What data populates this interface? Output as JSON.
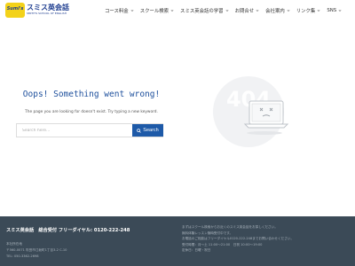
{
  "header": {
    "logo": {
      "badge_text": "Sumi's",
      "main_text": "スミス英会話",
      "sub_text": "SMITH'S SCHOOL OF ENGLISH"
    },
    "nav": [
      {
        "label": "コース料金"
      },
      {
        "label": "スクール検索"
      },
      {
        "label": "スミス英会話の学習"
      },
      {
        "label": "お問合せ"
      },
      {
        "label": "会社案内"
      },
      {
        "label": "リンク集"
      },
      {
        "label": "SNS"
      }
    ]
  },
  "main": {
    "error_title": "Oops! Something went wrong!",
    "message": "The page you are looking for doesn't exist. Try typing a new keyword.",
    "search": {
      "placeholder": "Search here...",
      "button_label": "Search"
    },
    "illustration": {
      "code": "404",
      "accent": "#d0d4d8"
    }
  },
  "footer": {
    "title": "スミス英会話　総合受付 フリーダイヤル: 0120-222-248",
    "left_lines": [
      "本社所在地",
      "〒560-0071 吹田市江坂町1丁目3-2 C-10",
      "TEL: 050-3362-2698"
    ],
    "right_lines": [
      "まずはスクール検索からお近くのスミス英会話をお探しください。",
      "無料体験レッスン随時受付中です。",
      "お電話のご相談はフリーダイヤル0120-222-248までお問い合わせください。",
      "受付時間：月〜土 11:00〜21:00　日祝 10:00〜19:00",
      "定休日：日曜・祝日"
    ],
    "bg_color": "#3b4a57"
  },
  "colors": {
    "accent_blue": "#1e5aa8",
    "title_blue": "#1d4f9c"
  }
}
